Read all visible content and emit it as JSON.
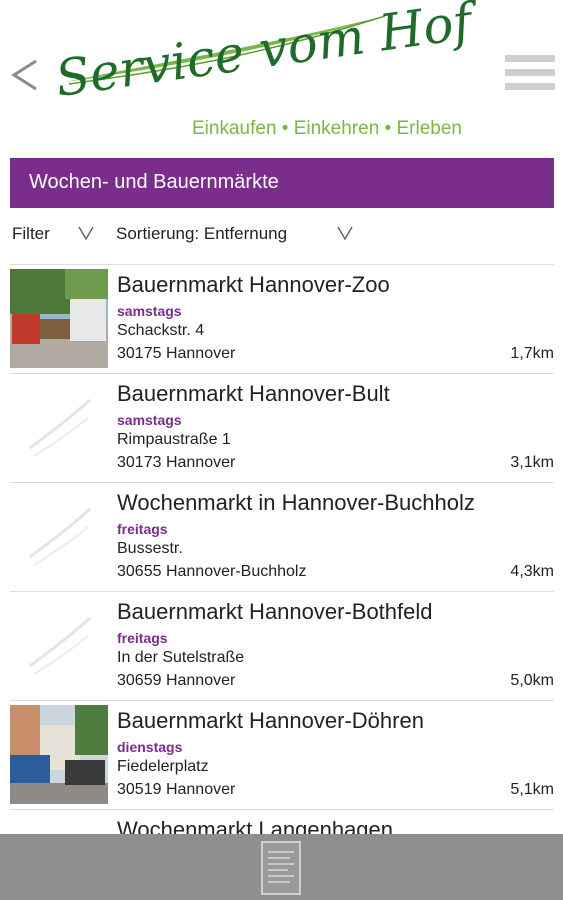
{
  "header": {
    "logo_title": "Service vom Hof",
    "logo_tagline": "Einkaufen • Einkehren • Erleben",
    "back_icon": "chevron-left-icon",
    "menu_icon": "hamburger-menu-icon"
  },
  "title_bar": {
    "title": "Wochen- und Bauernmärkte"
  },
  "filter": {
    "filter_label": "Filter",
    "sort_label": "Sortierung: Entfernung"
  },
  "markets": [
    {
      "name": "Bauernmarkt Hannover-Zoo",
      "day": "samstags",
      "street": "Schackstr. 4",
      "city": "30175 Hannover",
      "distance": "1,7km",
      "thumb": "photo"
    },
    {
      "name": "Bauernmarkt Hannover-Bult",
      "day": "samstags",
      "street": "Rimpaustraße 1",
      "city": "30173 Hannover",
      "distance": "3,1km",
      "thumb": "placeholder"
    },
    {
      "name": "Wochenmarkt in Hannover-Buchholz",
      "day": "freitags",
      "street": "Bussestr.",
      "city": "30655 Hannover-Buchholz",
      "distance": "4,3km",
      "thumb": "placeholder"
    },
    {
      "name": "Bauernmarkt Hannover-Bothfeld",
      "day": "freitags",
      "street": "In der Sutelstraße",
      "city": "30659 Hannover",
      "distance": "5,0km",
      "thumb": "placeholder"
    },
    {
      "name": "Bauernmarkt Hannover-Döhren",
      "day": "dienstags",
      "street": "Fiedelerplatz",
      "city": "30519 Hannover",
      "distance": "5,1km",
      "thumb": "photo"
    },
    {
      "name": "Wochenmarkt Langenhagen",
      "day": "",
      "street": "",
      "city": "",
      "distance": "",
      "thumb": "placeholder"
    }
  ],
  "colors": {
    "accent": "#7a2d8a",
    "logo_green": "#1f6b2a",
    "tagline_green": "#7ab648",
    "bottom_bar": "#8e8e8e"
  },
  "bottom_bar": {
    "icon": "document-list-icon"
  }
}
